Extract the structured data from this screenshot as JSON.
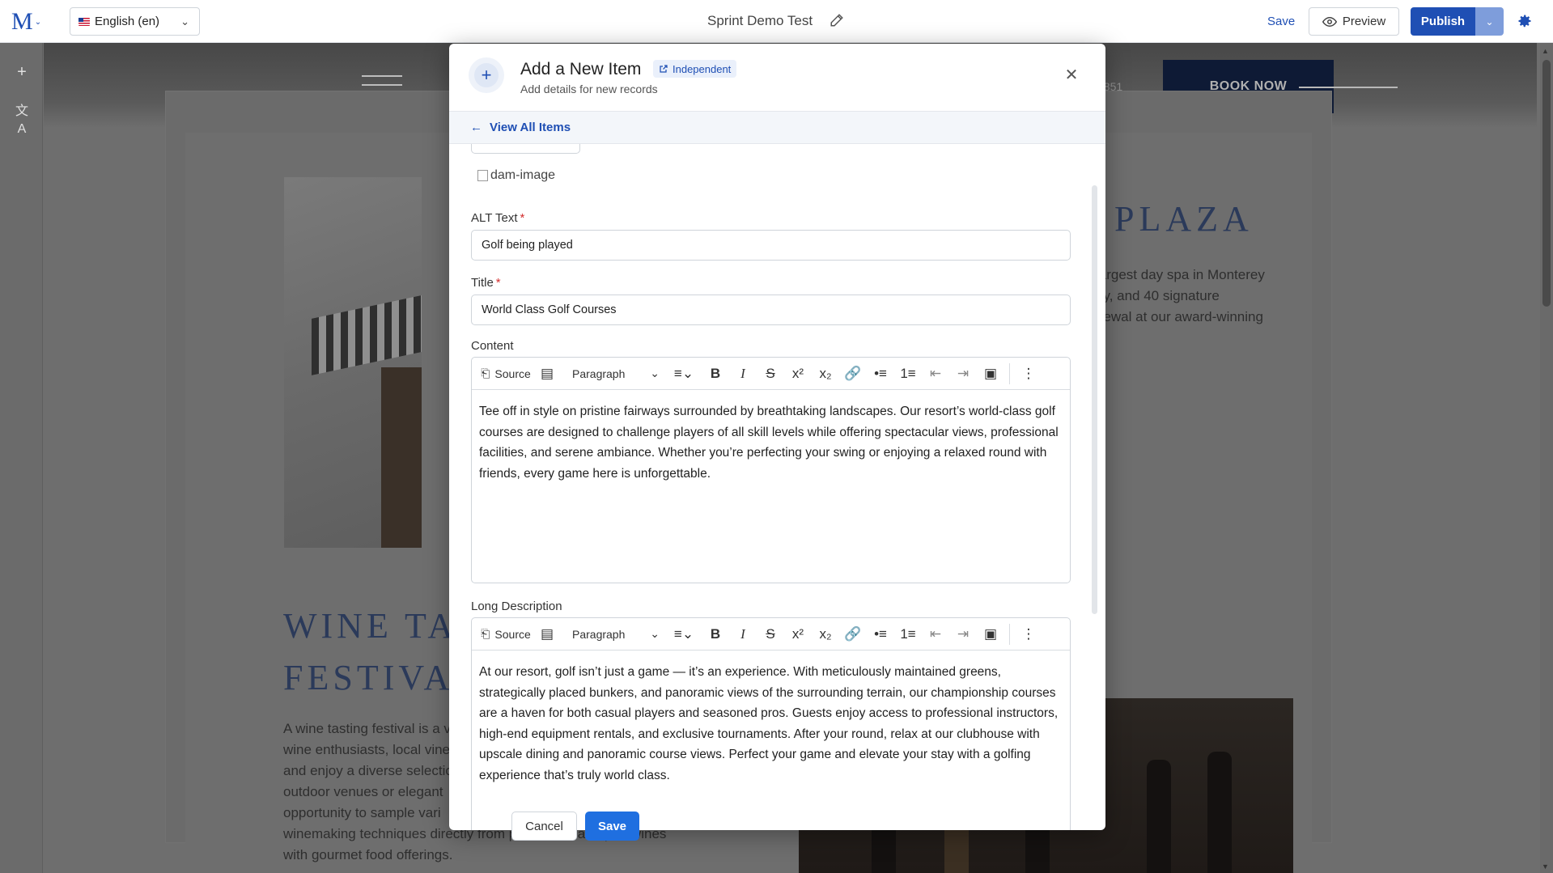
{
  "topbar": {
    "logo_letter": "M",
    "language": "English (en)",
    "page_name": "Sprint Demo Test",
    "save_label": "Save",
    "preview_label": "Preview",
    "publish_label": "Publish"
  },
  "site": {
    "phone_fragment": "5851",
    "book_now": "BOOK NOW",
    "plaza_heading": "PLAZA",
    "plaza_text": "largest day spa in Monterey\noy, and 40 signature\nnewal at our award-winning",
    "wine_heading_line1": "WINE TA",
    "wine_heading_line2": "FESTIVA",
    "wine_text": "A wine tasting festival is a v\nwine enthusiasts, local vine\nand enjoy a diverse selectio\noutdoor venues or elegant\nopportunity to sample vari\nwinemaking techniques directly from producers, and pair wines\nwith gourmet food offerings."
  },
  "modal": {
    "title": "Add a New Item",
    "badge": "Independent",
    "subtitle": "Add details for new records",
    "back_link": "View All Items",
    "image_alt_display": "dam-image",
    "fields": {
      "alt_text": {
        "label": "ALT Text",
        "value": "Golf being played"
      },
      "title": {
        "label": "Title",
        "value": "World Class Golf Courses"
      },
      "content": {
        "label": "Content",
        "value": "Tee off in style on pristine fairways surrounded by breathtaking landscapes. Our resort’s world-class golf courses are designed to challenge players of all skill levels while offering spectacular views, professional facilities, and serene ambiance. Whether you’re perfecting your swing or enjoying a relaxed round with friends, every game here is unforgettable."
      },
      "long_description": {
        "label": "Long Description",
        "value": "At our resort, golf isn’t just a game — it’s an experience. With meticulously maintained greens, strategically placed bunkers, and panoramic views of the surrounding terrain, our championship courses are a haven for both casual players and seasoned pros. Guests enjoy access to professional instructors, high-end equipment rentals, and exclusive tournaments. After your round, relax at our clubhouse with upscale dining and panoramic course views. Perfect your game and elevate your stay with a golfing experience that’s truly world class."
      }
    },
    "toolbar": {
      "source_label": "Source",
      "paragraph_label": "Paragraph"
    },
    "cancel_label": "Cancel",
    "save_label": "Save"
  }
}
